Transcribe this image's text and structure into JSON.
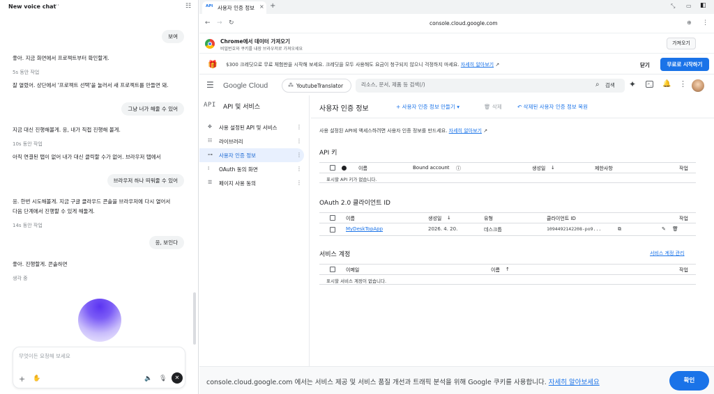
{
  "chat": {
    "title": "New voice chat",
    "messages": [
      {
        "role": "user",
        "text": "보여"
      },
      {
        "role": "assistant",
        "text": "좋아. 지금 화면에서 프로젝트부터 확인할게."
      },
      {
        "role": "meta",
        "text": "5s 동안 작업"
      },
      {
        "role": "assistant",
        "text": "잘 열렸어. 상단에서 '프로젝트 선택'을 눌러서 새 프로젝트를 만들면 돼."
      },
      {
        "role": "user",
        "text": "그냥 너가 해줄 수 있어"
      },
      {
        "role": "assistant",
        "text": "지금 대신 진행해볼게. 응, 내가 직접 진행해 볼게."
      },
      {
        "role": "meta",
        "text": "10s 동안 작업"
      },
      {
        "role": "assistant",
        "text": "아직 연결된 탭이 없어 내가 대신 클릭할 수가 없어. 브라우저 탭에서"
      },
      {
        "role": "user",
        "text": "브라우저 하나 띄워줄 수 있어"
      },
      {
        "role": "assistant",
        "text": "응. 한번 시도해볼게. 지금 구글 클라우드 콘솔을 브라우저에 다시 열어서"
      },
      {
        "role": "assistant",
        "text": "다음 단계에서 진행할 수 있게 해둘게."
      },
      {
        "role": "meta",
        "text": "14s 동안 작업"
      },
      {
        "role": "user",
        "text": "응, 보인다"
      },
      {
        "role": "assistant",
        "text": "좋아. 진행할게. 콘솔하면"
      },
      {
        "role": "meta",
        "text": "생각 중"
      }
    ],
    "composer": {
      "placeholder": "무엇이든 요청해 보세요"
    },
    "icons": {
      "more": "more-horizontal-icon",
      "sidebar": "sidebar-toggle-icon",
      "plus": "plus-icon",
      "hand": "hand-icon",
      "speaker": "speaker-icon",
      "mic": "mic-icon",
      "stop": "close-icon"
    }
  },
  "browser": {
    "tab": {
      "favicon": "API",
      "title": "사용자 인증 정보"
    },
    "url": "console.cloud.google.com",
    "import_banner": {
      "title": "Chrome에서 데이터 가져오기",
      "subtitle": "비밀번호와 쿠키를 내장 브라우저로 가져오세요",
      "button": "가져오기"
    },
    "trial_banner": {
      "text": "$300 크레딧으로 무료 체험판을 시작해 보세요. 크레딧을 모두 사용해도 요금이 청구되지 않으니 걱정하지 마세요.",
      "link": "자세히 알아보기",
      "dismiss": "닫기",
      "start": "무료로 시작하기"
    },
    "cookie_bar": {
      "text": "console.cloud.google.com 에서는 서비스 제공 및 서비스 품질 개선과 트래픽 분석을 위해 Google 쿠키를 사용합니다.",
      "link": "자세히 알아보세요",
      "confirm": "확인"
    }
  },
  "console": {
    "logo": "Google Cloud",
    "project": "YoutubeTranslator",
    "search_placeholder": "리소스, 문서, 제품 등 검색(/)",
    "search_button": "검색",
    "sidenav": {
      "badge": "API",
      "title": "API 및 서비스",
      "items": [
        {
          "label": "사용 설정된 API 및 서비스",
          "icon": "api-grid-icon",
          "active": false
        },
        {
          "label": "라이브러리",
          "icon": "library-icon",
          "active": false
        },
        {
          "label": "사용자 인증 정보",
          "icon": "key-icon",
          "active": true
        },
        {
          "label": "OAuth 동의 화면",
          "icon": "oauth-icon",
          "active": false
        },
        {
          "label": "페이지 사용 동의",
          "icon": "settings-list-icon",
          "active": false
        }
      ]
    },
    "page": {
      "title": "사용자 인증 정보",
      "create_button": "+ 사용자 인증 정보 만들기 ▾",
      "delete_button": "삭제",
      "restore_button": "삭제된 사용자 인증 정보 복원",
      "intro": "사용 설정된 API에 액세스하려면 사용자 인증 정보를 만드세요.",
      "intro_link": "자세히 알아보기"
    },
    "api_keys": {
      "title": "API 키",
      "columns": [
        "이름",
        "Bound account",
        "생성일",
        "제한사항",
        "작업"
      ],
      "empty": "표시할 API 키가 없습니다."
    },
    "oauth_clients": {
      "title": "OAuth 2.0 클라이언트 ID",
      "columns": [
        "이름",
        "생성일",
        "유형",
        "클라이언트 ID",
        "작업"
      ],
      "rows": [
        {
          "name": "MyDeskTopApp",
          "created": "2026. 4. 20.",
          "type": "데스크톱",
          "client_id": "1094492142208-po9..."
        }
      ]
    },
    "service_accounts": {
      "title": "서비스 계정",
      "manage_link": "서비스 계정 관리",
      "columns": [
        "이메일",
        "이름",
        "작업"
      ],
      "empty": "표시할 서비스 계정이 없습니다."
    }
  },
  "colors": {
    "accent": "#1a73e8",
    "active_nav_bg": "#e8f0fe",
    "orb": "#5b34f2"
  }
}
